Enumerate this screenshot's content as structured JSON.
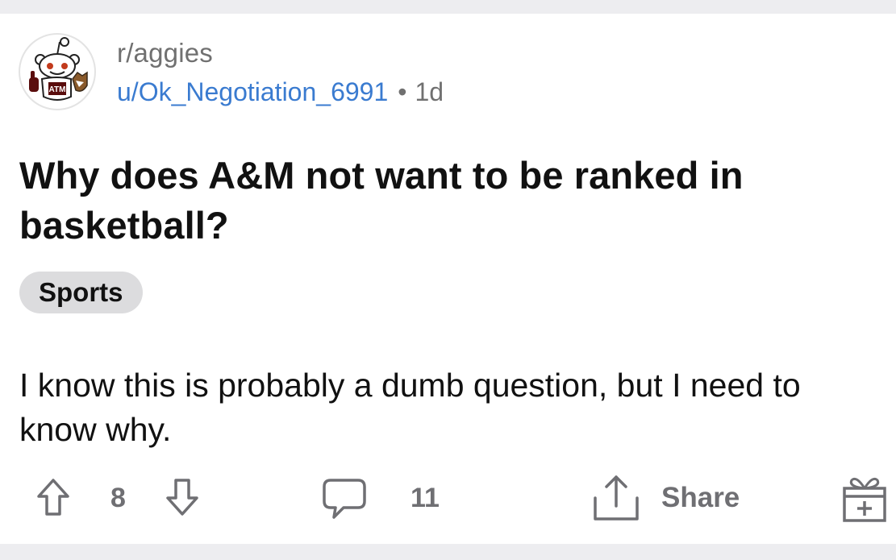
{
  "post": {
    "subreddit": "r/aggies",
    "username": "u/Ok_Negotiation_6991",
    "separator": "•",
    "age": "1d",
    "title": "Why does A&M not want to be ranked in basketball?",
    "flair": "Sports",
    "body": "I know this is probably a dumb question, but I need to know why."
  },
  "avatar": {
    "badge_text": "ATM",
    "icon": "subreddit-avatar-icon"
  },
  "actions": {
    "vote_count": "8",
    "comment_count": "11",
    "share_label": "Share"
  },
  "colors": {
    "username": "#3a7bd0",
    "secondary_text": "#707070",
    "action_gray": "#6f6f73",
    "flair_bg": "#dcdcde",
    "background": "#ededf0",
    "maroon": "#5a0d0d"
  }
}
